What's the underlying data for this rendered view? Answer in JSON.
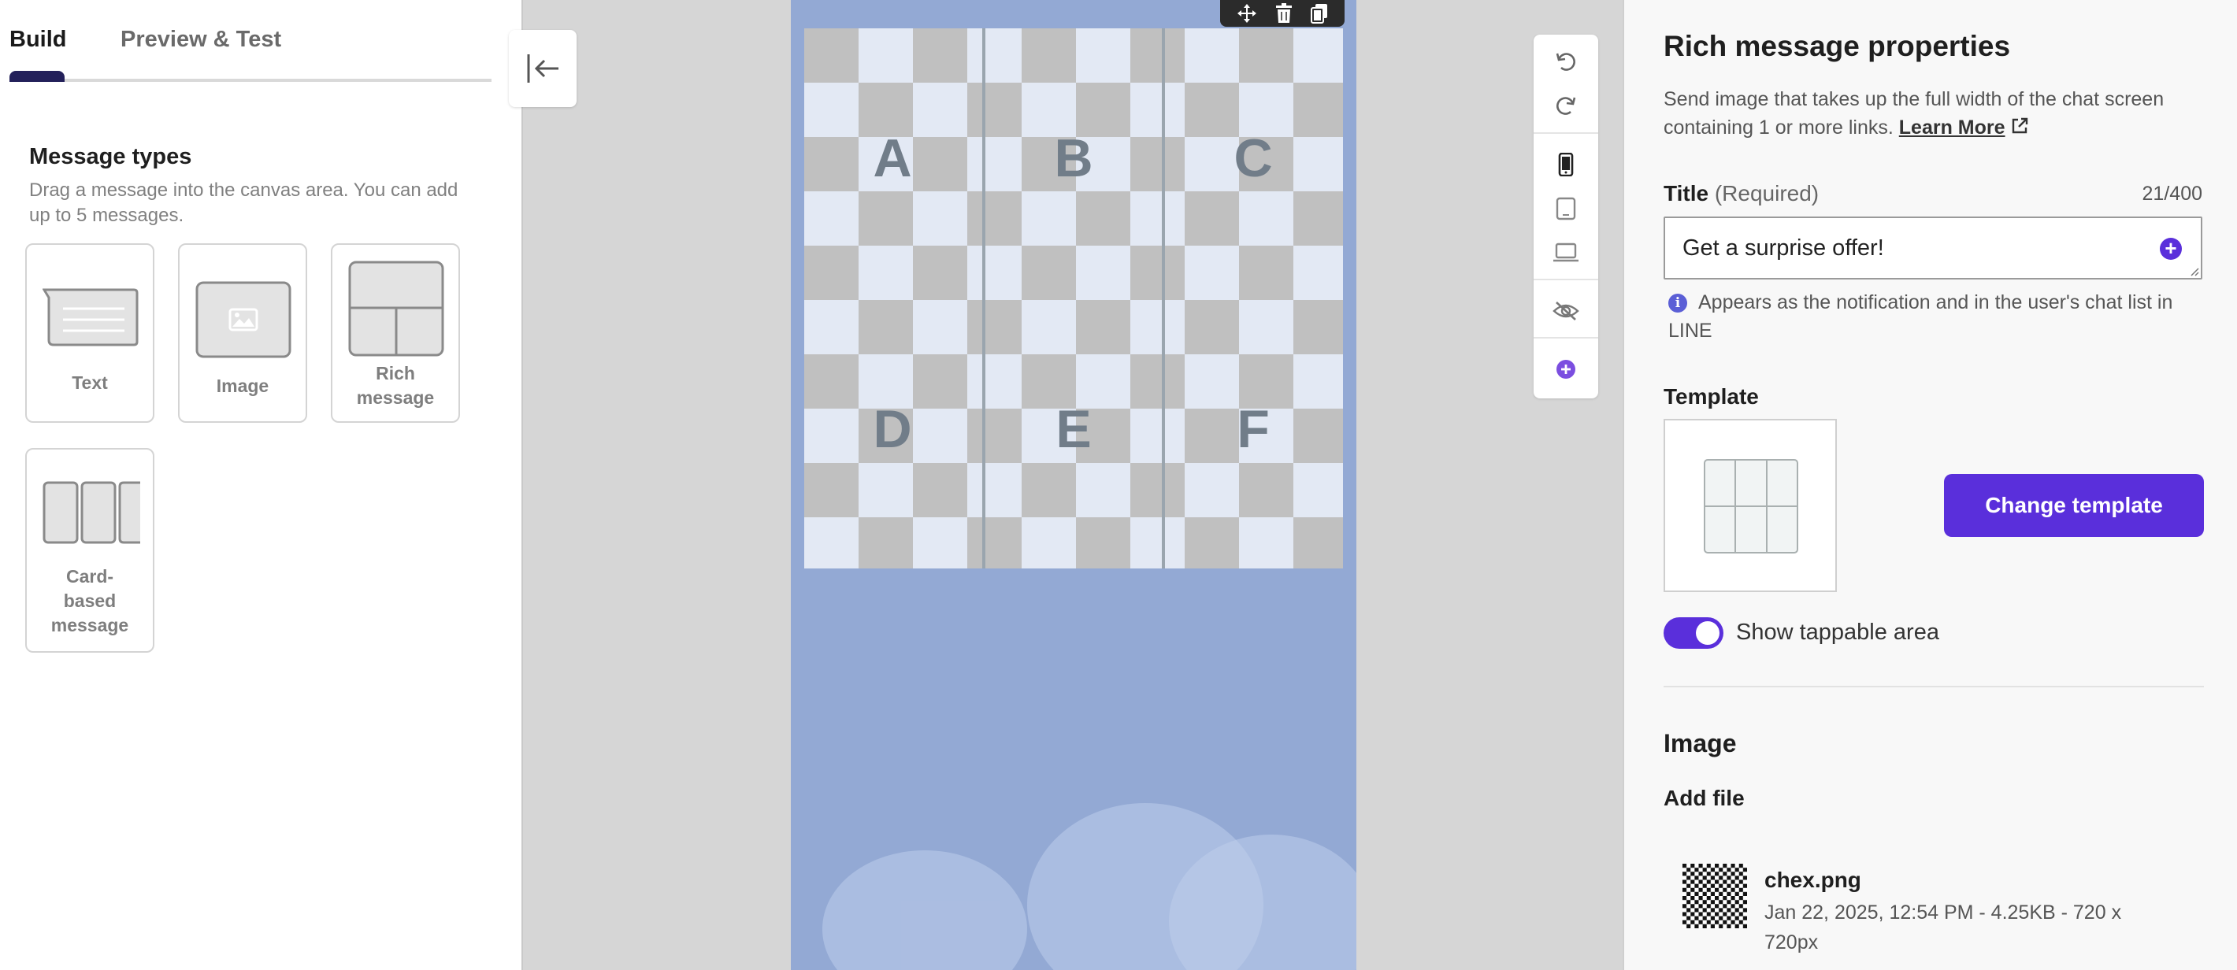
{
  "tabs": {
    "build": "Build",
    "preview": "Preview & Test"
  },
  "message_types": {
    "heading": "Message types",
    "description": "Drag a message into the canvas area. You can add up to 5 messages.",
    "cards": [
      {
        "label": "Text"
      },
      {
        "label": "Image"
      },
      {
        "label": "Rich message"
      },
      {
        "label": "Card-based message"
      }
    ]
  },
  "canvas": {
    "cells": [
      "A",
      "B",
      "C",
      "D",
      "E",
      "F"
    ]
  },
  "properties": {
    "title": "Rich message properties",
    "description": "Send image that takes up the full width of the chat screen containing 1 or more links.",
    "learn_more": "Learn More",
    "field_label": "Title",
    "field_required": "(Required)",
    "counter": "21/400",
    "title_value": "Get a surprise offer!",
    "hint": "Appears as the notification and in the user's chat list in LINE",
    "template_label": "Template",
    "change_template": "Change template",
    "toggle_label": "Show tappable area",
    "toggle_on": true,
    "image_heading": "Image",
    "add_file": "Add file",
    "file": {
      "name": "chex.png",
      "meta": "Jan 22, 2025, 12:54 PM  -  4.25KB  -  720 x 720px"
    }
  },
  "colors": {
    "accent": "#5a2fdb",
    "canvas_bg": "#93a9d4",
    "tab_indicator": "#23205a"
  }
}
